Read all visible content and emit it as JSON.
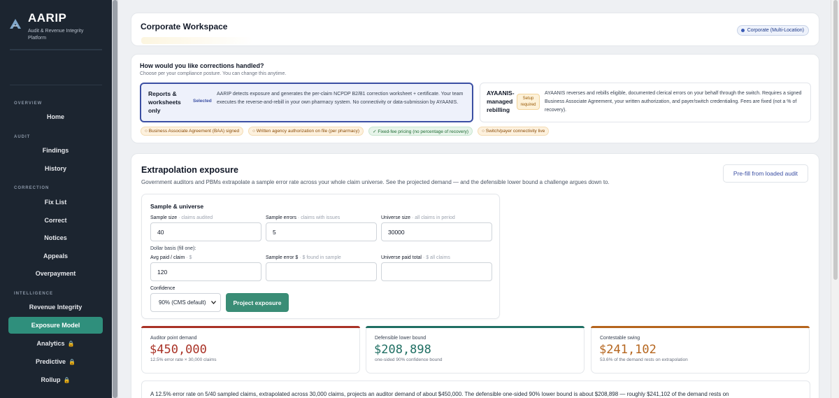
{
  "brand": {
    "title": "AARIP",
    "subtitle": "Audit & Revenue Integrity Platform"
  },
  "sidebar": {
    "sections": [
      {
        "label": "OVERVIEW",
        "items": [
          {
            "label": "Home",
            "locked": false,
            "active": false
          }
        ]
      },
      {
        "label": "AUDIT",
        "items": [
          {
            "label": "Findings"
          },
          {
            "label": "History"
          }
        ]
      },
      {
        "label": "CORRECTION",
        "items": [
          {
            "label": "Fix List"
          },
          {
            "label": "Correct"
          },
          {
            "label": "Notices"
          },
          {
            "label": "Appeals"
          },
          {
            "label": "Overpayment"
          }
        ]
      },
      {
        "label": "INTELLIGENCE",
        "items": [
          {
            "label": "Revenue Integrity"
          },
          {
            "label": "Exposure Model",
            "active": true
          },
          {
            "label": "Analytics",
            "locked": true
          },
          {
            "label": "Predictive",
            "locked": true
          },
          {
            "label": "Rollup",
            "locked": true
          }
        ]
      }
    ]
  },
  "workspace": {
    "title": "Corporate Workspace",
    "badge": "Corporate (Multi-Location)"
  },
  "corrections": {
    "title": "How would you like corrections handled?",
    "subtitle": "Choose per your compliance posture. You can change this anytime.",
    "option1": {
      "title": "Reports & worksheets only",
      "tag": "Selected",
      "desc": "AARIP detects exposure and generates the per-claim NCPDP B2/B1 correction worksheet + certificate. Your team executes the reverse-and-rebill in your own pharmacy system. No connectivity or data-submission by AYAANIS."
    },
    "option2": {
      "title": "AYAANIS-managed rebilling",
      "tag": "Setup required",
      "desc": "AYAANIS reverses and rebills eligible, documented clerical errors on your behalf through the switch. Requires a signed Business Associate Agreement, your written authorization, and payer/switch credentialing. Fees are fixed (not a % of recovery)."
    },
    "chips": [
      "○ Business Associate Agreement (BAA) signed",
      "○ Written agency authorization on file (per pharmacy)",
      "✓ Fixed-fee pricing (no percentage of recovery)",
      "○ Switch/payer connectivity live"
    ]
  },
  "exposure": {
    "title": "Extrapolation exposure",
    "subtitle": "Government auditors and PBMs extrapolate a sample error rate across your whole claim universe. See the projected demand — and the defensible lower bound a challenge argues down to.",
    "prefill": "Pre-fill from loaded audit",
    "sample": {
      "title": "Sample & universe",
      "sample_size_label": "Sample size",
      "sample_size_hint": "· claims audited",
      "sample_size_value": "40",
      "sample_errors_label": "Sample errors",
      "sample_errors_hint": "· claims with issues",
      "sample_errors_value": "5",
      "universe_label": "Universe size",
      "universe_hint": "· all claims in period",
      "universe_value": "30000",
      "dollar_basis": "Dollar basis (fill one):",
      "avg_paid_label": "Avg paid / claim",
      "avg_paid_hint": "· $",
      "avg_paid_value": "120",
      "sample_err_dollar_label": "Sample error $",
      "sample_err_dollar_hint": "· $ found in sample",
      "sample_err_dollar_value": "",
      "universe_paid_label": "Universe paid total",
      "universe_paid_hint": "· $ all claims",
      "universe_paid_value": "",
      "confidence_label": "Confidence",
      "confidence_value": "90% (CMS default)",
      "project_button": "Project exposure"
    },
    "metrics": [
      {
        "label": "Auditor point demand",
        "value": "$450,000",
        "sub": "12.5% error rate × 30,000 claims",
        "color": "#a93226"
      },
      {
        "label": "Defensible lower bound",
        "value": "$208,898",
        "sub": "one-sided 90% confidence bound",
        "color": "#1f6f63"
      },
      {
        "label": "Contestable swing",
        "value": "$241,102",
        "sub": "53.6% of the demand rests on extrapolation",
        "color": "#b5651d"
      }
    ],
    "summary": "A 12.5% error rate on 5/40 sampled claims, extrapolated across 30,000 claims, projects an auditor demand of about $450,000. The defensible one-sided 90% lower bound is about $208,898 — roughly $241,102 of the demand rests on"
  },
  "colors": {
    "sidebar_bg": "#1c2530",
    "accent": "#2f8f7c",
    "selected_border": "#3b4fa3"
  }
}
